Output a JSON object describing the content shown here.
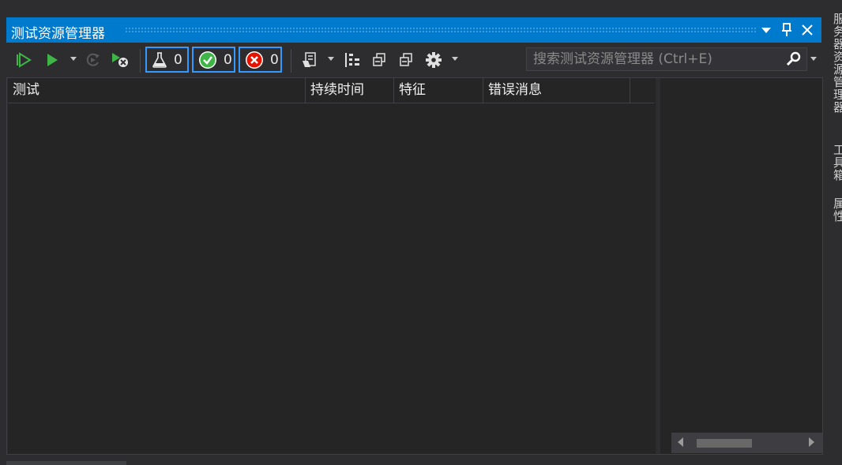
{
  "window": {
    "title": "测试资源管理器"
  },
  "toolbar": {
    "counters": [
      {
        "icon": "flask-icon",
        "count": "0"
      },
      {
        "icon": "passed-check-icon",
        "count": "0",
        "color": "#3fb548"
      },
      {
        "icon": "failed-x-icon",
        "count": "0",
        "color": "#e51400"
      }
    ]
  },
  "search": {
    "placeholder": "搜索测试资源管理器 (Ctrl+E)"
  },
  "columns": [
    "测试",
    "持续时间",
    "特征",
    "错误消息"
  ],
  "side_tabs": [
    "服务器资源管理器",
    "工具箱",
    "属性"
  ],
  "colors": {
    "accent": "#007acc",
    "background": "#2d2d30",
    "panel": "#252526",
    "run_green": "#3fb548"
  }
}
